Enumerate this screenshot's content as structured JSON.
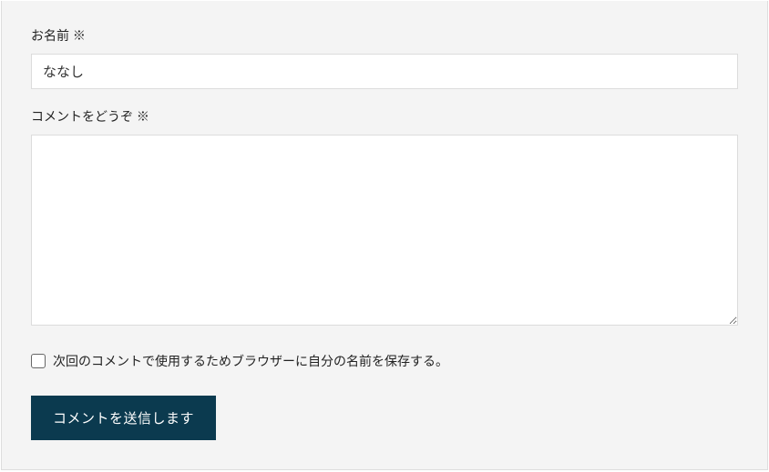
{
  "form": {
    "name_label": "お名前 ※",
    "name_value": "ななし",
    "comment_label": "コメントをどうぞ ※",
    "comment_value": "",
    "save_checkbox_label": "次回のコメントで使用するためブラウザーに自分の名前を保存する。",
    "submit_label": "コメントを送信します"
  }
}
